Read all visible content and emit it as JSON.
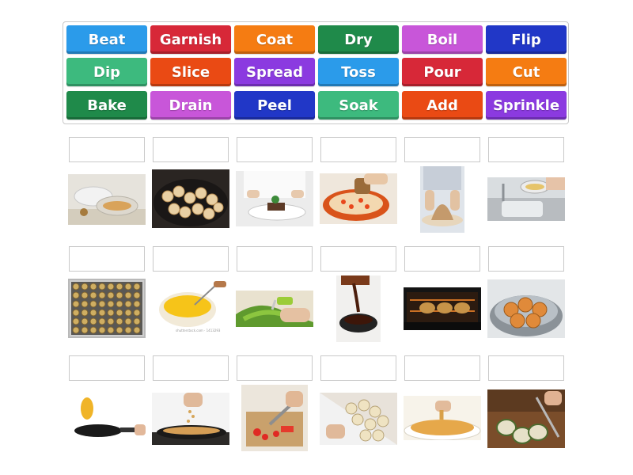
{
  "word_bank": {
    "tiles": [
      {
        "label": "Beat",
        "color": "#2b9bea"
      },
      {
        "label": "Garnish",
        "color": "#d72838"
      },
      {
        "label": "Coat",
        "color": "#f57c12"
      },
      {
        "label": "Dry",
        "color": "#1f8a4a"
      },
      {
        "label": "Boil",
        "color": "#c856d9"
      },
      {
        "label": "Flip",
        "color": "#2137c7"
      },
      {
        "label": "Dip",
        "color": "#3dba7e"
      },
      {
        "label": "Slice",
        "color": "#ea4a14"
      },
      {
        "label": "Spread",
        "color": "#8b3ae0"
      },
      {
        "label": "Toss",
        "color": "#2b9bea"
      },
      {
        "label": "Pour",
        "color": "#d72838"
      },
      {
        "label": "Cut",
        "color": "#f57c12"
      },
      {
        "label": "Bake",
        "color": "#1f8a4a"
      },
      {
        "label": "Drain",
        "color": "#c856d9"
      },
      {
        "label": "Peel",
        "color": "#2137c7"
      },
      {
        "label": "Soak",
        "color": "#3dba7e"
      },
      {
        "label": "Add",
        "color": "#ea4a14"
      },
      {
        "label": "Sprinkle",
        "color": "#8b3ae0"
      }
    ]
  },
  "image_rows": [
    [
      "mixing-bowl-photo",
      "frying-slices-photo",
      "chef-garnish-photo",
      "orange-pot-photo",
      "hands-dough-photo",
      "sink-drain-photo"
    ],
    [
      "baking-tray-photo",
      "bowl-eggs-photo",
      "peeler-cucumber-photo",
      "chocolate-pour-photo",
      "oven-bake-photo",
      "boiling-pot-photo"
    ],
    [
      "pan-flip-photo",
      "pan-sprinkle-photo",
      "chopping-board-photo",
      "eggplant-slices-photo",
      "dip-chip-photo",
      "knife-cut-photo"
    ]
  ],
  "tiny_caption": "shutterstock.com · 1413293"
}
